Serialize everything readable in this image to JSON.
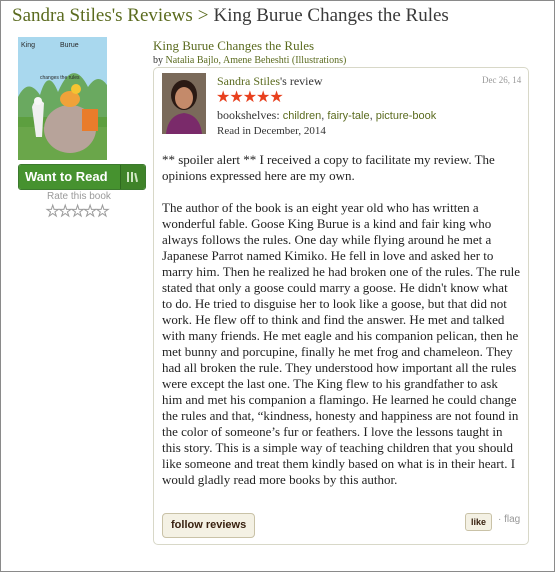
{
  "header": {
    "reviews_link": "Sandra Stiles's Reviews",
    "separator": ">",
    "current_title": "King Burue Changes the Rules"
  },
  "book": {
    "cover_text_top_left": "King",
    "cover_text_top_right": "Burue",
    "cover_text_middle": "changes the rules",
    "title": "King Burue Changes the Rules",
    "by_label": "by",
    "authors": "Natalia Bajlo, Amene Beheshti",
    "illustrations_label": "(Illustrations)"
  },
  "actions": {
    "want_to_read": "Want to Read",
    "rate_label": "Rate this book",
    "rate_stars": "★★★★★"
  },
  "review": {
    "reviewer_name": "Sandra Stiles",
    "review_suffix": "'s review",
    "date": "Dec 26, 14",
    "rating_stars": "★★★★★",
    "shelves_label": "bookshelves:",
    "shelves": [
      "children",
      "fairy-tale",
      "picture-book"
    ],
    "read_date": "Read in December, 2014",
    "paragraphs": [
      "** spoiler alert ** I received a copy to facilitate my review. The opinions expressed here are my own.",
      "The author of the book is an eight year old who has written a wonderful fable. Goose King Burue is a kind and fair king who always follows the rules. One day while flying around he met a Japanese Parrot named Kimiko. He fell in love and asked her to marry him. Then he realized he had broken one of the rules. The rule stated that only a goose could marry a goose. He didn't know what to do. He tried to disguise her to look like a goose, but that did not work. He flew off to think and find the answer. He met and talked with many friends. He met eagle and his companion pelican, then he met bunny and porcupine, finally he met frog and chameleon. They had all broken the rule. They understood how important all the rules were except the last one. The King flew to his grandfather to ask him and met his companion a flamingo. He learned he could change the rules and that, “kindness, honesty and happiness are not found in the color of someone’s fur or feathers. I love the lessons taught in this story. This is a simple way of teaching children that you should like someone and treat them kindly based on what is in their heart. I would gladly read more books by this author."
    ],
    "follow_label": "follow reviews",
    "like_label": "like",
    "dot": "·",
    "flag_label": "flag"
  },
  "colors": {
    "link_green": "#5b6b1f",
    "button_green": "#46922f",
    "star_red": "#e8401e"
  }
}
